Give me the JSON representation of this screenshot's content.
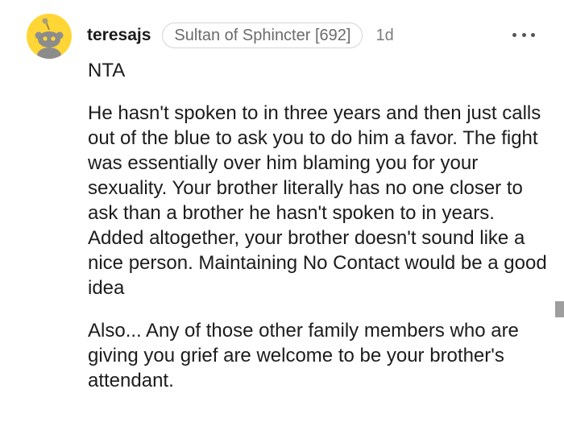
{
  "comment": {
    "username": "teresajs",
    "flair": "Sultan of Sphincter [692]",
    "time": "1d",
    "paragraphs": [
      "NTA",
      "He hasn't spoken to in three years and then just calls out of the blue to ask you to do him a favor. The fight was essentially over him blaming you for your sexuality. Your brother literally has no one closer to ask than a brother he hasn't spoken to in years. Added altogether, your brother doesn't sound like a nice person. Maintaining No Contact would be a good idea",
      "Also... Any of those other family members who are giving you grief are welcome to be your brother's attendant."
    ]
  },
  "icons": {
    "avatar": "snoo-avatar-icon",
    "more": "more-options-icon"
  },
  "colors": {
    "avatar_bg": "#ffd635",
    "flair_border": "#d4d4d4",
    "meta_text": "#7c7c7c",
    "body_text": "#1c1c1c"
  }
}
